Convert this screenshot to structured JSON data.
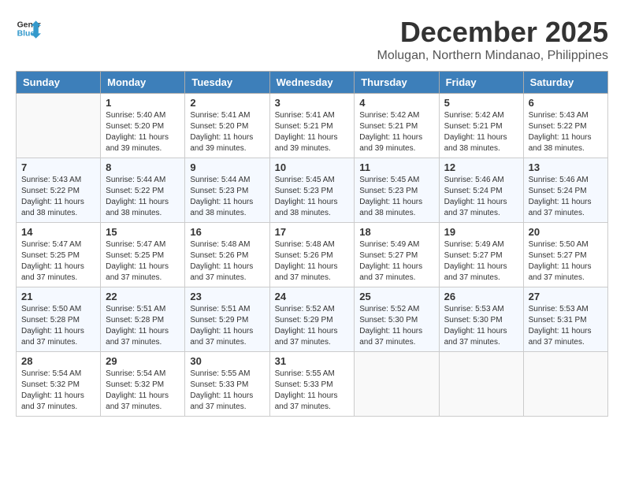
{
  "app": {
    "name": "GeneralBlue",
    "logo_text_part1": "General",
    "logo_text_part2": "Blue"
  },
  "header": {
    "month_year": "December 2025",
    "location": "Molugan, Northern Mindanao, Philippines"
  },
  "days_of_week": [
    "Sunday",
    "Monday",
    "Tuesday",
    "Wednesday",
    "Thursday",
    "Friday",
    "Saturday"
  ],
  "weeks": [
    [
      {
        "day": "",
        "info": ""
      },
      {
        "day": "1",
        "info": "Sunrise: 5:40 AM\nSunset: 5:20 PM\nDaylight: 11 hours\nand 39 minutes."
      },
      {
        "day": "2",
        "info": "Sunrise: 5:41 AM\nSunset: 5:20 PM\nDaylight: 11 hours\nand 39 minutes."
      },
      {
        "day": "3",
        "info": "Sunrise: 5:41 AM\nSunset: 5:21 PM\nDaylight: 11 hours\nand 39 minutes."
      },
      {
        "day": "4",
        "info": "Sunrise: 5:42 AM\nSunset: 5:21 PM\nDaylight: 11 hours\nand 39 minutes."
      },
      {
        "day": "5",
        "info": "Sunrise: 5:42 AM\nSunset: 5:21 PM\nDaylight: 11 hours\nand 38 minutes."
      },
      {
        "day": "6",
        "info": "Sunrise: 5:43 AM\nSunset: 5:22 PM\nDaylight: 11 hours\nand 38 minutes."
      }
    ],
    [
      {
        "day": "7",
        "info": "Sunrise: 5:43 AM\nSunset: 5:22 PM\nDaylight: 11 hours\nand 38 minutes."
      },
      {
        "day": "8",
        "info": "Sunrise: 5:44 AM\nSunset: 5:22 PM\nDaylight: 11 hours\nand 38 minutes."
      },
      {
        "day": "9",
        "info": "Sunrise: 5:44 AM\nSunset: 5:23 PM\nDaylight: 11 hours\nand 38 minutes."
      },
      {
        "day": "10",
        "info": "Sunrise: 5:45 AM\nSunset: 5:23 PM\nDaylight: 11 hours\nand 38 minutes."
      },
      {
        "day": "11",
        "info": "Sunrise: 5:45 AM\nSunset: 5:23 PM\nDaylight: 11 hours\nand 38 minutes."
      },
      {
        "day": "12",
        "info": "Sunrise: 5:46 AM\nSunset: 5:24 PM\nDaylight: 11 hours\nand 37 minutes."
      },
      {
        "day": "13",
        "info": "Sunrise: 5:46 AM\nSunset: 5:24 PM\nDaylight: 11 hours\nand 37 minutes."
      }
    ],
    [
      {
        "day": "14",
        "info": "Sunrise: 5:47 AM\nSunset: 5:25 PM\nDaylight: 11 hours\nand 37 minutes."
      },
      {
        "day": "15",
        "info": "Sunrise: 5:47 AM\nSunset: 5:25 PM\nDaylight: 11 hours\nand 37 minutes."
      },
      {
        "day": "16",
        "info": "Sunrise: 5:48 AM\nSunset: 5:26 PM\nDaylight: 11 hours\nand 37 minutes."
      },
      {
        "day": "17",
        "info": "Sunrise: 5:48 AM\nSunset: 5:26 PM\nDaylight: 11 hours\nand 37 minutes."
      },
      {
        "day": "18",
        "info": "Sunrise: 5:49 AM\nSunset: 5:27 PM\nDaylight: 11 hours\nand 37 minutes."
      },
      {
        "day": "19",
        "info": "Sunrise: 5:49 AM\nSunset: 5:27 PM\nDaylight: 11 hours\nand 37 minutes."
      },
      {
        "day": "20",
        "info": "Sunrise: 5:50 AM\nSunset: 5:27 PM\nDaylight: 11 hours\nand 37 minutes."
      }
    ],
    [
      {
        "day": "21",
        "info": "Sunrise: 5:50 AM\nSunset: 5:28 PM\nDaylight: 11 hours\nand 37 minutes."
      },
      {
        "day": "22",
        "info": "Sunrise: 5:51 AM\nSunset: 5:28 PM\nDaylight: 11 hours\nand 37 minutes."
      },
      {
        "day": "23",
        "info": "Sunrise: 5:51 AM\nSunset: 5:29 PM\nDaylight: 11 hours\nand 37 minutes."
      },
      {
        "day": "24",
        "info": "Sunrise: 5:52 AM\nSunset: 5:29 PM\nDaylight: 11 hours\nand 37 minutes."
      },
      {
        "day": "25",
        "info": "Sunrise: 5:52 AM\nSunset: 5:30 PM\nDaylight: 11 hours\nand 37 minutes."
      },
      {
        "day": "26",
        "info": "Sunrise: 5:53 AM\nSunset: 5:30 PM\nDaylight: 11 hours\nand 37 minutes."
      },
      {
        "day": "27",
        "info": "Sunrise: 5:53 AM\nSunset: 5:31 PM\nDaylight: 11 hours\nand 37 minutes."
      }
    ],
    [
      {
        "day": "28",
        "info": "Sunrise: 5:54 AM\nSunset: 5:32 PM\nDaylight: 11 hours\nand 37 minutes."
      },
      {
        "day": "29",
        "info": "Sunrise: 5:54 AM\nSunset: 5:32 PM\nDaylight: 11 hours\nand 37 minutes."
      },
      {
        "day": "30",
        "info": "Sunrise: 5:55 AM\nSunset: 5:33 PM\nDaylight: 11 hours\nand 37 minutes."
      },
      {
        "day": "31",
        "info": "Sunrise: 5:55 AM\nSunset: 5:33 PM\nDaylight: 11 hours\nand 37 minutes."
      },
      {
        "day": "",
        "info": ""
      },
      {
        "day": "",
        "info": ""
      },
      {
        "day": "",
        "info": ""
      }
    ]
  ]
}
